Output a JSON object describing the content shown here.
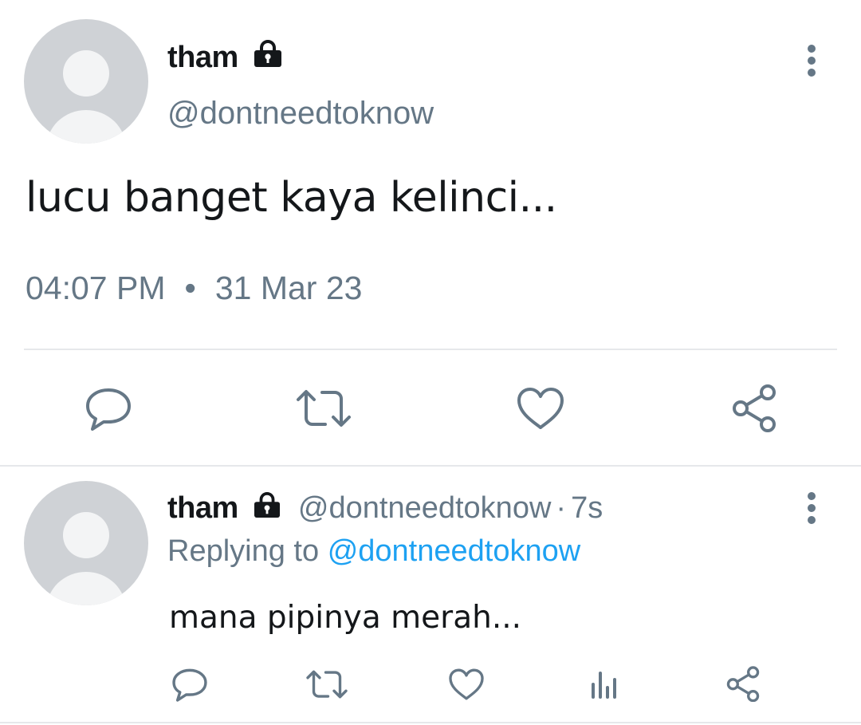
{
  "main_tweet": {
    "display_name": "tham",
    "handle": "@dontneedtoknow",
    "text": "lucu banget kaya kelinci...",
    "time": "04:07 PM",
    "separator": "•",
    "date": "31 Mar 23",
    "actions": [
      "reply-icon",
      "retweet-icon",
      "like-icon",
      "share-icon"
    ]
  },
  "reply": {
    "display_name": "tham",
    "handle": "@dontneedtoknow",
    "separator": "·",
    "time_ago": "7s",
    "replying_prefix": "Replying to",
    "replying_to": "@dontneedtoknow",
    "text": "mana pipinya merah...",
    "actions": [
      "reply-icon",
      "retweet-icon",
      "like-icon",
      "analytics-icon",
      "share-icon"
    ]
  },
  "colors": {
    "text_primary": "#14171a",
    "text_secondary": "#657786",
    "link": "#1da1f2",
    "divider": "#e6e8eb",
    "avatar_bg": "#cfd2d6"
  }
}
